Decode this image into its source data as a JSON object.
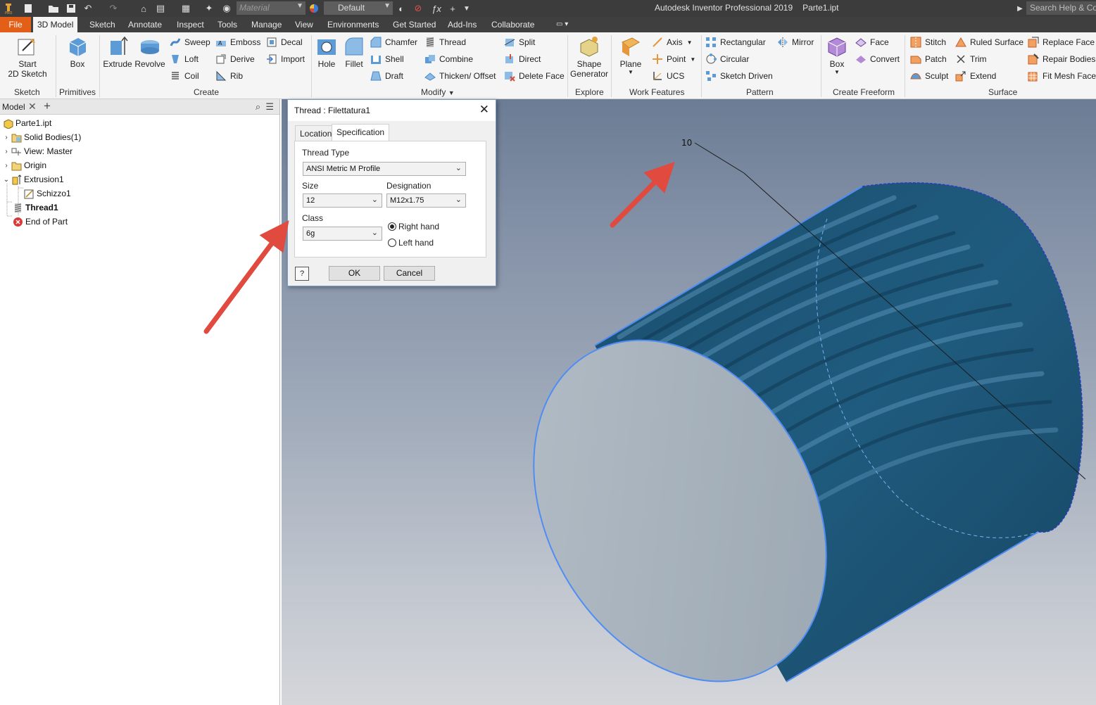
{
  "app": {
    "title": "Autodesk Inventor Professional 2019",
    "document": "Parte1.ipt",
    "search_placeholder": "Search Help & Co",
    "material_placeholder": "Material",
    "appearance_value": "Default"
  },
  "menu_tabs": [
    "File",
    "3D Model",
    "Sketch",
    "Annotate",
    "Inspect",
    "Tools",
    "Manage",
    "View",
    "Environments",
    "Get Started",
    "Add-Ins",
    "Collaborate"
  ],
  "active_tab": "3D Model",
  "ribbon": {
    "sketch": {
      "start_line1": "Start",
      "start_line2": "2D Sketch",
      "group": "Sketch"
    },
    "primitives": {
      "box": "Box",
      "group": "Primitives"
    },
    "create": {
      "extrude": "Extrude",
      "revolve": "Revolve",
      "sweep": "Sweep",
      "loft": "Loft",
      "coil": "Coil",
      "emboss": "Emboss",
      "derive": "Derive",
      "rib": "Rib",
      "decal": "Decal",
      "import": "Import",
      "group": "Create"
    },
    "modify": {
      "hole": "Hole",
      "fillet": "Fillet",
      "chamfer": "Chamfer",
      "shell": "Shell",
      "draft": "Draft",
      "thread": "Thread",
      "combine": "Combine",
      "thicken": "Thicken/ Offset",
      "split": "Split",
      "direct": "Direct",
      "delete_face": "Delete Face",
      "group": "Modify"
    },
    "explore": {
      "shape_line1": "Shape",
      "shape_line2": "Generator",
      "group": "Explore"
    },
    "work_features": {
      "plane": "Plane",
      "axis": "Axis",
      "point": "Point",
      "ucs": "UCS",
      "group": "Work Features"
    },
    "pattern": {
      "rectangular": "Rectangular",
      "circular": "Circular",
      "sketch_driven": "Sketch Driven",
      "mirror": "Mirror",
      "group": "Pattern"
    },
    "freeform": {
      "box": "Box",
      "face": "Face",
      "convert": "Convert",
      "group": "Create Freeform"
    },
    "surface": {
      "stitch": "Stitch",
      "patch": "Patch",
      "sculpt": "Sculpt",
      "ruled_surface": "Ruled Surface",
      "trim": "Trim",
      "extend": "Extend",
      "replace_face": "Replace Face",
      "repair_bodies": "Repair Bodies",
      "fit_mesh_face": "Fit Mesh Face",
      "group": "Surface"
    }
  },
  "browser": {
    "tab_label": "Model",
    "tree": [
      {
        "label": "Parte1.ipt",
        "icon": "part-icon"
      },
      {
        "label": "Solid Bodies(1)",
        "icon": "solid-bodies-icon"
      },
      {
        "label": "View: Master",
        "icon": "view-icon"
      },
      {
        "label": "Origin",
        "icon": "folder-icon"
      },
      {
        "label": "Extrusion1",
        "icon": "extrusion-icon"
      },
      {
        "label": "Schizzo1",
        "icon": "sketch-icon"
      },
      {
        "label": "Thread1",
        "icon": "thread-icon"
      },
      {
        "label": "End of Part",
        "icon": "end-of-part-icon"
      }
    ]
  },
  "dialog": {
    "title": "Thread : Filettatura1",
    "tabs": [
      "Location",
      "Specification"
    ],
    "active_tab": "Specification",
    "thread_type_label": "Thread Type",
    "thread_type_value": "ANSI Metric M Profile",
    "size_label": "Size",
    "size_value": "12",
    "designation_label": "Designation",
    "designation_value": "M12x1.75",
    "class_label": "Class",
    "class_value": "6g",
    "right_hand": "Right hand",
    "left_hand": "Left hand",
    "hand_selected": "Right hand",
    "ok": "OK",
    "cancel": "Cancel",
    "help": "?"
  },
  "viewport": {
    "dimension_value": "10",
    "colors": {
      "body": "#1d5778",
      "face": "#a9b4bd",
      "edge": "#4f8df5",
      "arrow": "#e04a3f"
    }
  }
}
